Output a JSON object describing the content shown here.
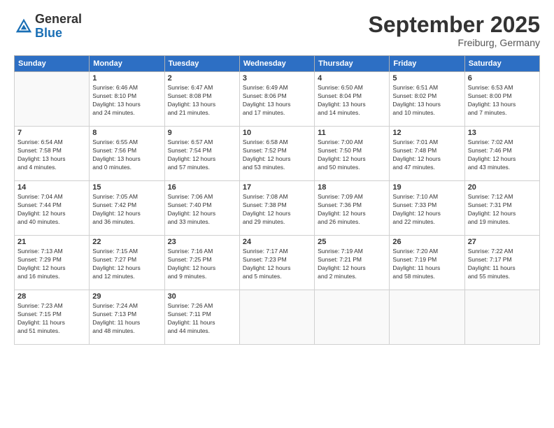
{
  "logo": {
    "general": "General",
    "blue": "Blue"
  },
  "title": "September 2025",
  "subtitle": "Freiburg, Germany",
  "headers": [
    "Sunday",
    "Monday",
    "Tuesday",
    "Wednesday",
    "Thursday",
    "Friday",
    "Saturday"
  ],
  "weeks": [
    [
      {
        "day": "",
        "info": ""
      },
      {
        "day": "1",
        "info": "Sunrise: 6:46 AM\nSunset: 8:10 PM\nDaylight: 13 hours\nand 24 minutes."
      },
      {
        "day": "2",
        "info": "Sunrise: 6:47 AM\nSunset: 8:08 PM\nDaylight: 13 hours\nand 21 minutes."
      },
      {
        "day": "3",
        "info": "Sunrise: 6:49 AM\nSunset: 8:06 PM\nDaylight: 13 hours\nand 17 minutes."
      },
      {
        "day": "4",
        "info": "Sunrise: 6:50 AM\nSunset: 8:04 PM\nDaylight: 13 hours\nand 14 minutes."
      },
      {
        "day": "5",
        "info": "Sunrise: 6:51 AM\nSunset: 8:02 PM\nDaylight: 13 hours\nand 10 minutes."
      },
      {
        "day": "6",
        "info": "Sunrise: 6:53 AM\nSunset: 8:00 PM\nDaylight: 13 hours\nand 7 minutes."
      }
    ],
    [
      {
        "day": "7",
        "info": "Sunrise: 6:54 AM\nSunset: 7:58 PM\nDaylight: 13 hours\nand 4 minutes."
      },
      {
        "day": "8",
        "info": "Sunrise: 6:55 AM\nSunset: 7:56 PM\nDaylight: 13 hours\nand 0 minutes."
      },
      {
        "day": "9",
        "info": "Sunrise: 6:57 AM\nSunset: 7:54 PM\nDaylight: 12 hours\nand 57 minutes."
      },
      {
        "day": "10",
        "info": "Sunrise: 6:58 AM\nSunset: 7:52 PM\nDaylight: 12 hours\nand 53 minutes."
      },
      {
        "day": "11",
        "info": "Sunrise: 7:00 AM\nSunset: 7:50 PM\nDaylight: 12 hours\nand 50 minutes."
      },
      {
        "day": "12",
        "info": "Sunrise: 7:01 AM\nSunset: 7:48 PM\nDaylight: 12 hours\nand 47 minutes."
      },
      {
        "day": "13",
        "info": "Sunrise: 7:02 AM\nSunset: 7:46 PM\nDaylight: 12 hours\nand 43 minutes."
      }
    ],
    [
      {
        "day": "14",
        "info": "Sunrise: 7:04 AM\nSunset: 7:44 PM\nDaylight: 12 hours\nand 40 minutes."
      },
      {
        "day": "15",
        "info": "Sunrise: 7:05 AM\nSunset: 7:42 PM\nDaylight: 12 hours\nand 36 minutes."
      },
      {
        "day": "16",
        "info": "Sunrise: 7:06 AM\nSunset: 7:40 PM\nDaylight: 12 hours\nand 33 minutes."
      },
      {
        "day": "17",
        "info": "Sunrise: 7:08 AM\nSunset: 7:38 PM\nDaylight: 12 hours\nand 29 minutes."
      },
      {
        "day": "18",
        "info": "Sunrise: 7:09 AM\nSunset: 7:36 PM\nDaylight: 12 hours\nand 26 minutes."
      },
      {
        "day": "19",
        "info": "Sunrise: 7:10 AM\nSunset: 7:33 PM\nDaylight: 12 hours\nand 22 minutes."
      },
      {
        "day": "20",
        "info": "Sunrise: 7:12 AM\nSunset: 7:31 PM\nDaylight: 12 hours\nand 19 minutes."
      }
    ],
    [
      {
        "day": "21",
        "info": "Sunrise: 7:13 AM\nSunset: 7:29 PM\nDaylight: 12 hours\nand 16 minutes."
      },
      {
        "day": "22",
        "info": "Sunrise: 7:15 AM\nSunset: 7:27 PM\nDaylight: 12 hours\nand 12 minutes."
      },
      {
        "day": "23",
        "info": "Sunrise: 7:16 AM\nSunset: 7:25 PM\nDaylight: 12 hours\nand 9 minutes."
      },
      {
        "day": "24",
        "info": "Sunrise: 7:17 AM\nSunset: 7:23 PM\nDaylight: 12 hours\nand 5 minutes."
      },
      {
        "day": "25",
        "info": "Sunrise: 7:19 AM\nSunset: 7:21 PM\nDaylight: 12 hours\nand 2 minutes."
      },
      {
        "day": "26",
        "info": "Sunrise: 7:20 AM\nSunset: 7:19 PM\nDaylight: 11 hours\nand 58 minutes."
      },
      {
        "day": "27",
        "info": "Sunrise: 7:22 AM\nSunset: 7:17 PM\nDaylight: 11 hours\nand 55 minutes."
      }
    ],
    [
      {
        "day": "28",
        "info": "Sunrise: 7:23 AM\nSunset: 7:15 PM\nDaylight: 11 hours\nand 51 minutes."
      },
      {
        "day": "29",
        "info": "Sunrise: 7:24 AM\nSunset: 7:13 PM\nDaylight: 11 hours\nand 48 minutes."
      },
      {
        "day": "30",
        "info": "Sunrise: 7:26 AM\nSunset: 7:11 PM\nDaylight: 11 hours\nand 44 minutes."
      },
      {
        "day": "",
        "info": ""
      },
      {
        "day": "",
        "info": ""
      },
      {
        "day": "",
        "info": ""
      },
      {
        "day": "",
        "info": ""
      }
    ]
  ]
}
